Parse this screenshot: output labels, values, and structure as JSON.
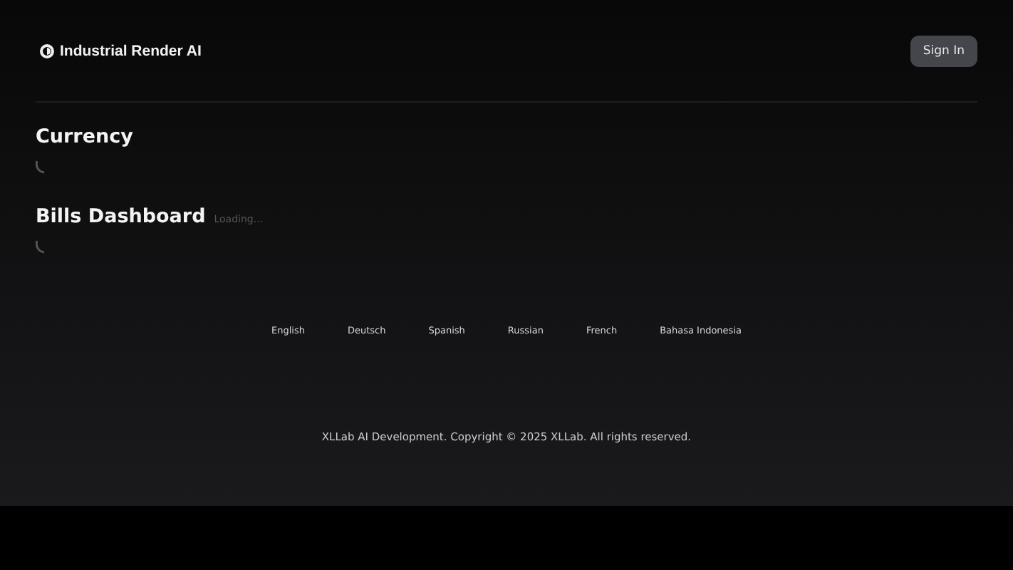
{
  "header": {
    "brand": "Industrial Render AI",
    "sign_in": "Sign In"
  },
  "sections": [
    {
      "title": "Currency"
    },
    {
      "title": "Bills Dashboard",
      "status": "Loading..."
    }
  ],
  "languages": [
    "English",
    "Deutsch",
    "Spanish",
    "Russian",
    "French",
    "Bahasa Indonesia"
  ],
  "footer": {
    "copyright": "XLLab AI Development. Copyright © 2025 XLLab. All rights reserved."
  }
}
